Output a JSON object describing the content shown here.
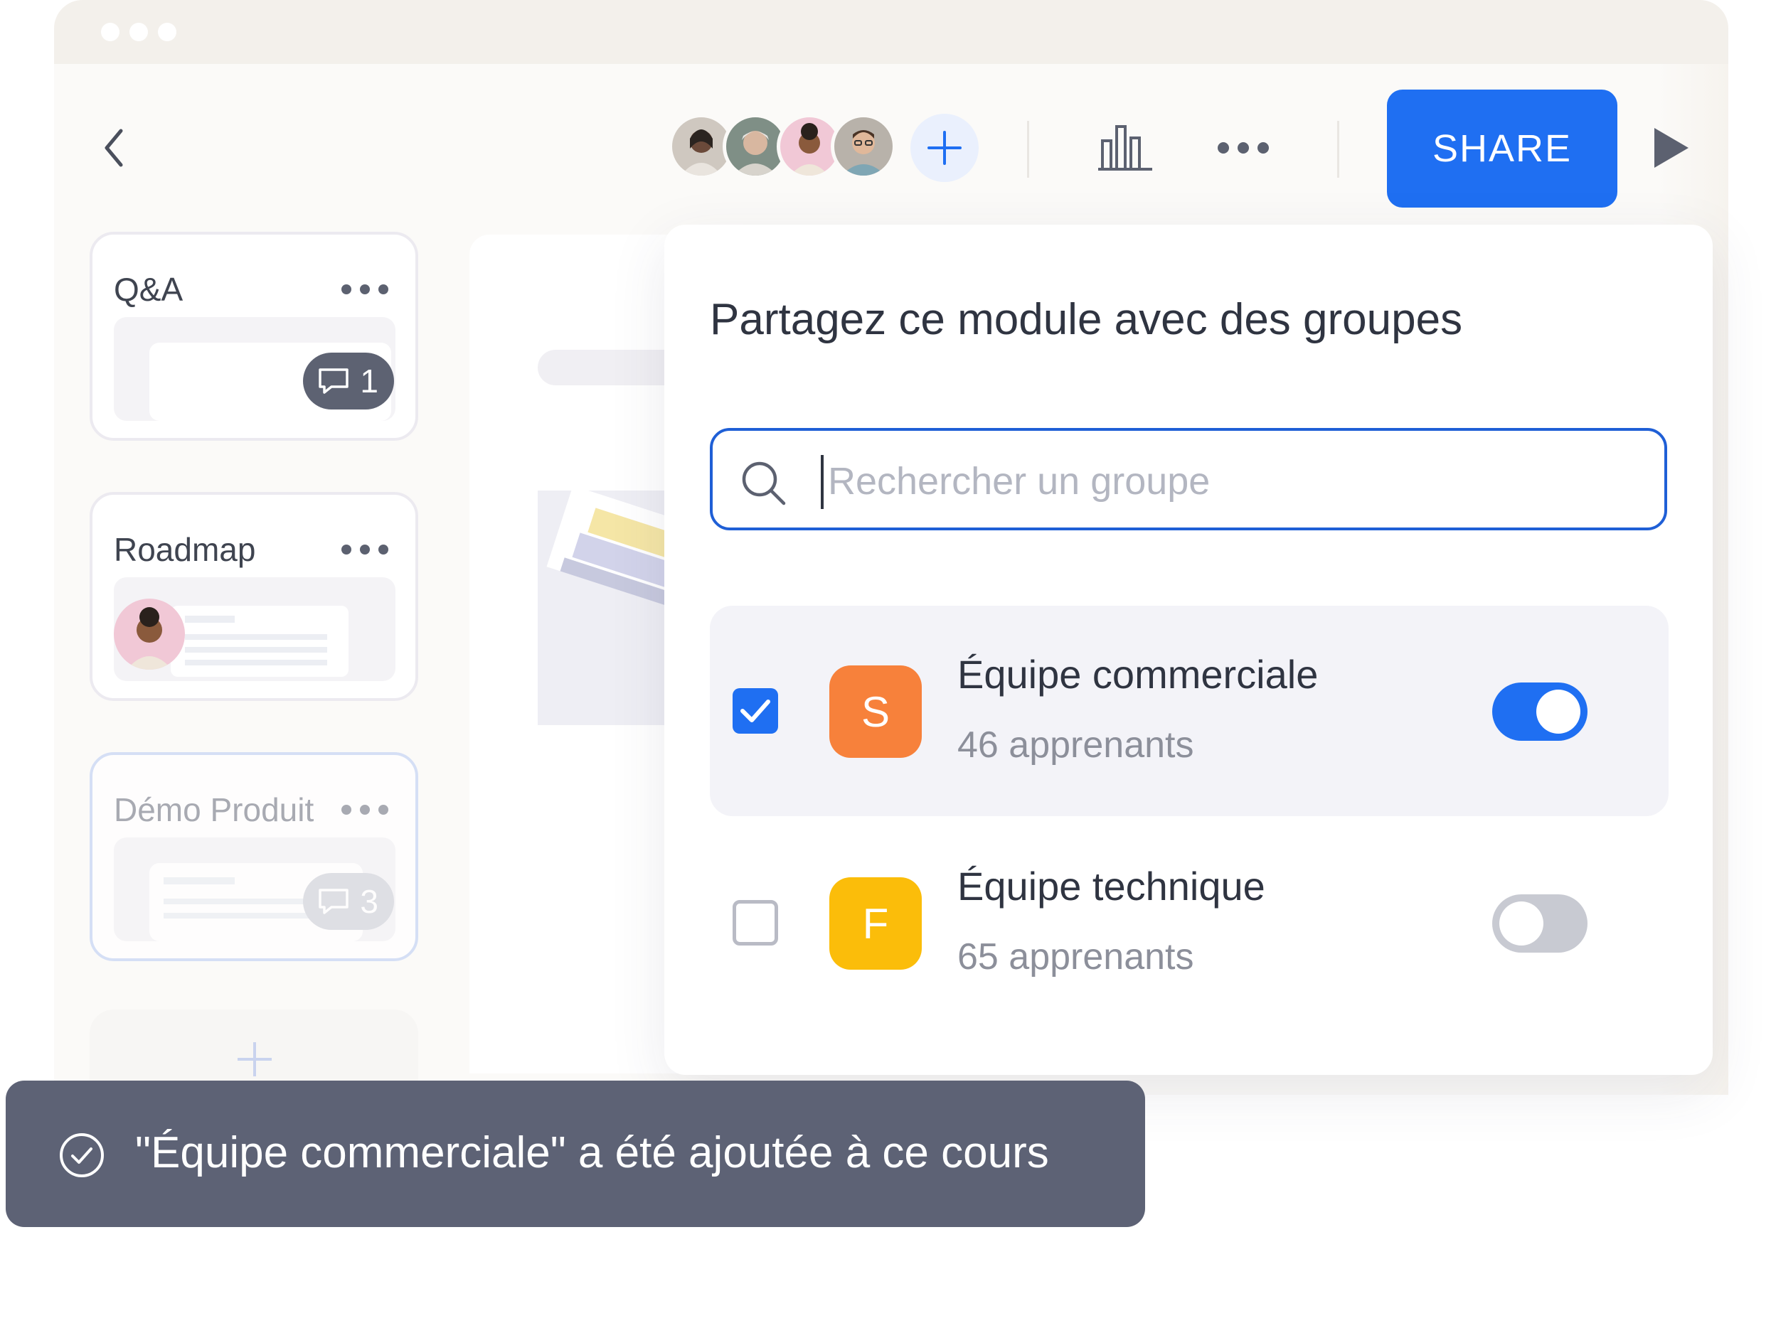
{
  "toolbar": {
    "share_label": "SHARE",
    "icons": [
      "chevron-left-icon",
      "plus-icon",
      "bar-chart-icon",
      "more-horizontal-icon",
      "play-icon"
    ],
    "accent_color": "#1f6ff2"
  },
  "collaborators": [
    {
      "name": "avatar-1",
      "bg": "#c9c3bc"
    },
    {
      "name": "avatar-2",
      "bg": "#7f8f86"
    },
    {
      "name": "avatar-3",
      "bg": "#f1c8d6"
    },
    {
      "name": "avatar-4",
      "bg": "#b8b2aa"
    }
  ],
  "modules": [
    {
      "title": "Q&A",
      "comments": "1"
    },
    {
      "title": "Roadmap"
    },
    {
      "title": "Démo Produit",
      "comments": "3"
    }
  ],
  "share_modal": {
    "title": "Partagez ce module avec des groupes",
    "search_placeholder": "Rechercher un groupe",
    "search_value": "",
    "groups": [
      {
        "initial": "S",
        "name": "Équipe commerciale",
        "count": "46 apprenants",
        "checked": true,
        "enabled": true,
        "color": "#f7813b"
      },
      {
        "initial": "F",
        "name": "Équipe technique",
        "count": "65 apprenants",
        "checked": false,
        "enabled": false,
        "color": "#fbbd0a"
      }
    ]
  },
  "toast": {
    "message": "\"Équipe commerciale\" a été ajoutée à ce cours",
    "icon": "check-circle-icon"
  }
}
